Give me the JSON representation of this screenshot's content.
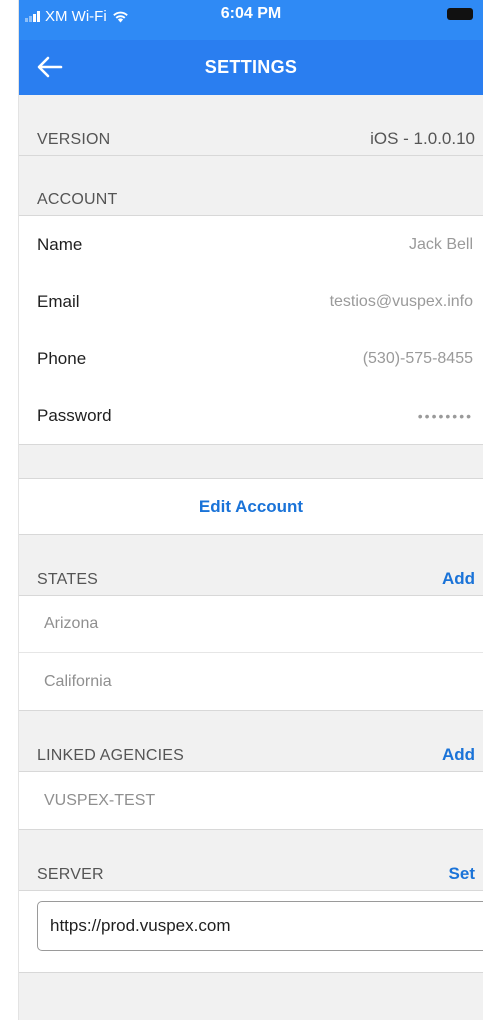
{
  "status_bar": {
    "carrier": "XM Wi-Fi",
    "time": "6:04 PM"
  },
  "nav": {
    "title": "SETTINGS",
    "back_icon": "arrow-left-icon"
  },
  "version": {
    "label": "VERSION",
    "value": "iOS - 1.0.0.10"
  },
  "account": {
    "header": "ACCOUNT",
    "rows": [
      {
        "label": "Name",
        "value": "Jack Bell"
      },
      {
        "label": "Email",
        "value": "testios@vuspex.info"
      },
      {
        "label": "Phone",
        "value": "(530)-575-8455"
      },
      {
        "label": "Password",
        "value": "••••••••"
      }
    ],
    "edit_label": "Edit Account"
  },
  "states": {
    "header": "STATES",
    "action": "Add",
    "items": [
      "Arizona",
      "California"
    ]
  },
  "linked_agencies": {
    "header": "LINKED AGENCIES",
    "action": "Add",
    "items": [
      "VUSPEX-TEST"
    ]
  },
  "server": {
    "header": "SERVER",
    "action": "Set",
    "value": "https://prod.vuspex.com"
  },
  "colors": {
    "status_bar": "#2f8af5",
    "nav_bar": "#2a7ef0",
    "accent": "#1a73d8",
    "background": "#f1f1f1"
  }
}
